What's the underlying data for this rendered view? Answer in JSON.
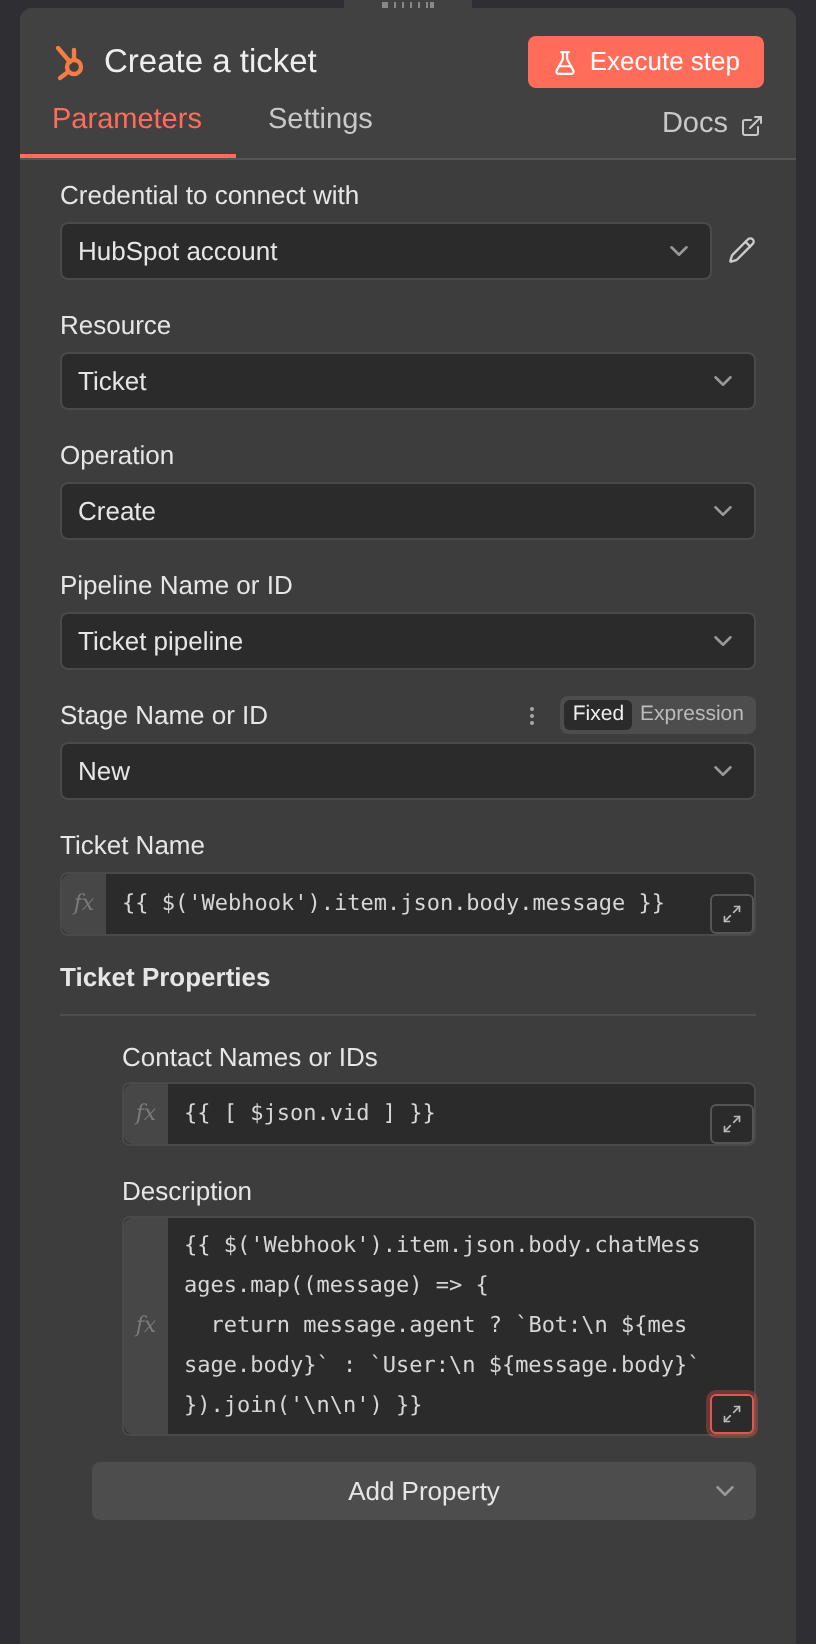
{
  "header": {
    "title": "Create a ticket",
    "execute_button": "Execute step"
  },
  "tabs": [
    {
      "label": "Parameters",
      "selected": true
    },
    {
      "label": "Settings",
      "selected": false
    }
  ],
  "docs_link": "Docs",
  "fields": [
    {
      "kind": "select",
      "label": "Credential to connect with",
      "value": "HubSpot account",
      "editable": true
    },
    {
      "kind": "select",
      "label": "Resource",
      "value": "Ticket"
    },
    {
      "kind": "select",
      "label": "Operation",
      "value": "Create"
    },
    {
      "kind": "select",
      "label": "Pipeline Name or ID",
      "value": "Ticket pipeline"
    },
    {
      "kind": "select",
      "label": "Stage Name or ID",
      "value": "New",
      "mode_options": [
        {
          "label": "Fixed",
          "selected": true
        },
        {
          "label": "Expression",
          "selected": false
        }
      ]
    },
    {
      "kind": "expression",
      "label": "Ticket Name",
      "value": "{{ $('Webhook').item.json.body.message }}",
      "fx": "fx",
      "highlighted": false
    }
  ],
  "section": {
    "title": "Ticket Properties",
    "fields": [
      {
        "kind": "expression",
        "label": "Contact Names or IDs",
        "value": "{{ [ $json.vid ] }}",
        "fx": "fx",
        "highlighted": false
      },
      {
        "kind": "expression",
        "label": "Description",
        "value": "{{ $('Webhook').item.json.body.chatMessages.map((message) => {\n  return message.agent ? `Bot:\\n ${message.body}` : `User:\\n ${message.body}`\n}).join('\\n\\n') }}",
        "fx": "fx",
        "highlighted": true
      }
    ],
    "add_button": "Add Property"
  }
}
